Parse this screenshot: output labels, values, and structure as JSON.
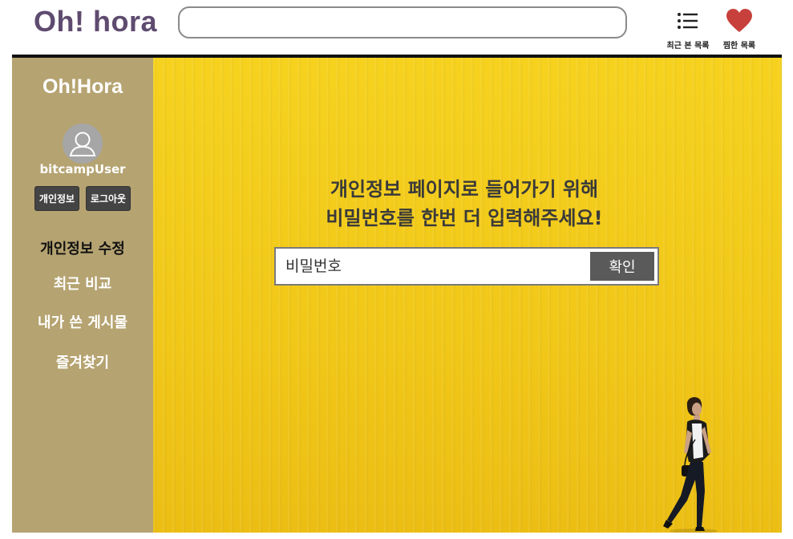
{
  "header": {
    "logo": "Oh! hora",
    "search": {
      "value": "",
      "placeholder": ""
    },
    "recent_label": "최근 본 목록",
    "wish_label": "찜한 목록"
  },
  "sidebar": {
    "brand": "Oh!Hora",
    "username": "bitcampUser",
    "info_button": "개인정보",
    "logout_button": "로그아웃",
    "menu": [
      {
        "label": "개인정보 수정",
        "active": true
      },
      {
        "label": "최근 비교",
        "active": false
      },
      {
        "label": "내가 쓴 게시물",
        "active": false
      },
      {
        "label": "즐겨찾기",
        "active": false
      }
    ]
  },
  "main": {
    "prompt_line1": "개인정보 페이지로 들어가기 위해",
    "prompt_line2": "비밀번호를 한번 더 입력해주세요!",
    "password_placeholder": "비밀번호",
    "confirm_button": "확인"
  },
  "icons": {
    "recent": "list-icon",
    "wish": "heart-icon",
    "avatar": "user-avatar-icon"
  },
  "colors": {
    "logo": "#5f4b6f",
    "sidebar_bg": "#b5a371",
    "main_bg": "#f4cd1c",
    "button_dark": "#444444",
    "heart": "#c8403c"
  }
}
